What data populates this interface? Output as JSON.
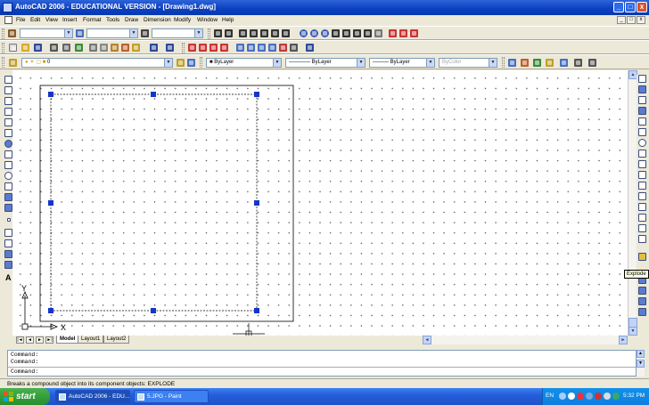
{
  "window": {
    "title": "AutoCAD 2006 - EDUCATIONAL VERSION - [Drawing1.dwg]",
    "minimize": "_",
    "maximize": "□",
    "close": "x"
  },
  "menubar": {
    "items": [
      "File",
      "Edit",
      "View",
      "Insert",
      "Format",
      "Tools",
      "Draw",
      "Dimension",
      "Modify",
      "Window",
      "Help"
    ],
    "mdi_min": "_",
    "mdi_max": "□",
    "mdi_close": "x"
  },
  "layers_toolbar": {
    "layer_value": "0",
    "color_value": "ByLayer",
    "linetype_value": "ByLayer",
    "lineweight_value": "ByLayer",
    "plotstyle_value": "ByColor"
  },
  "layout_tabs": {
    "nav": [
      "|◄",
      "◄",
      "►",
      "►|"
    ],
    "tabs": [
      "Model",
      "Layout1",
      "Layout2"
    ],
    "active": "Model"
  },
  "ucs": {
    "x_label": "X",
    "y_label": "Y"
  },
  "tooltip": "Explode",
  "command": {
    "lines": [
      "Command:",
      "Command:"
    ],
    "prompt": "Command:"
  },
  "status": {
    "text": "Breaks a compound object into its component objects:  EXPLODE"
  },
  "taskbar": {
    "start": "start",
    "tasks": [
      "AutoCAD 2006 - EDU...",
      "5.JPG - Paint"
    ],
    "lang": "EN",
    "clock": "5:32 PM"
  },
  "colors": {
    "titlebar": "#0a3fbf",
    "grip": "#1436c8",
    "taskbar": "#245edb",
    "start": "#33a03a"
  }
}
